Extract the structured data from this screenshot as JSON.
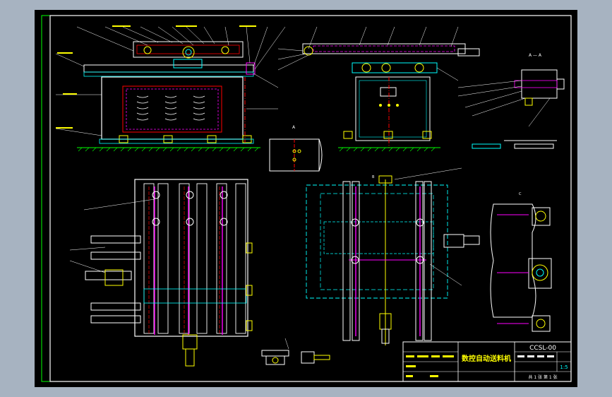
{
  "drawing": {
    "title": "数控自动送料机",
    "drawing_no": "CCSL-00",
    "scale": "1:5",
    "sheet_info": "共 1 张 第 1 张",
    "view_label_a": "A",
    "view_label_a_section": "A — A",
    "view_label_b": "B",
    "view_label_c": "C"
  },
  "colors": {
    "background": "#000000",
    "frame": "#ffffff",
    "outer_border": "#00ff00",
    "part_yellow": "#ffff00",
    "part_cyan": "#00ffff",
    "part_magenta": "#ff00ff",
    "part_red": "#ff0000",
    "part_green": "#00ff00",
    "hatch_blue": "#3f6fff"
  }
}
